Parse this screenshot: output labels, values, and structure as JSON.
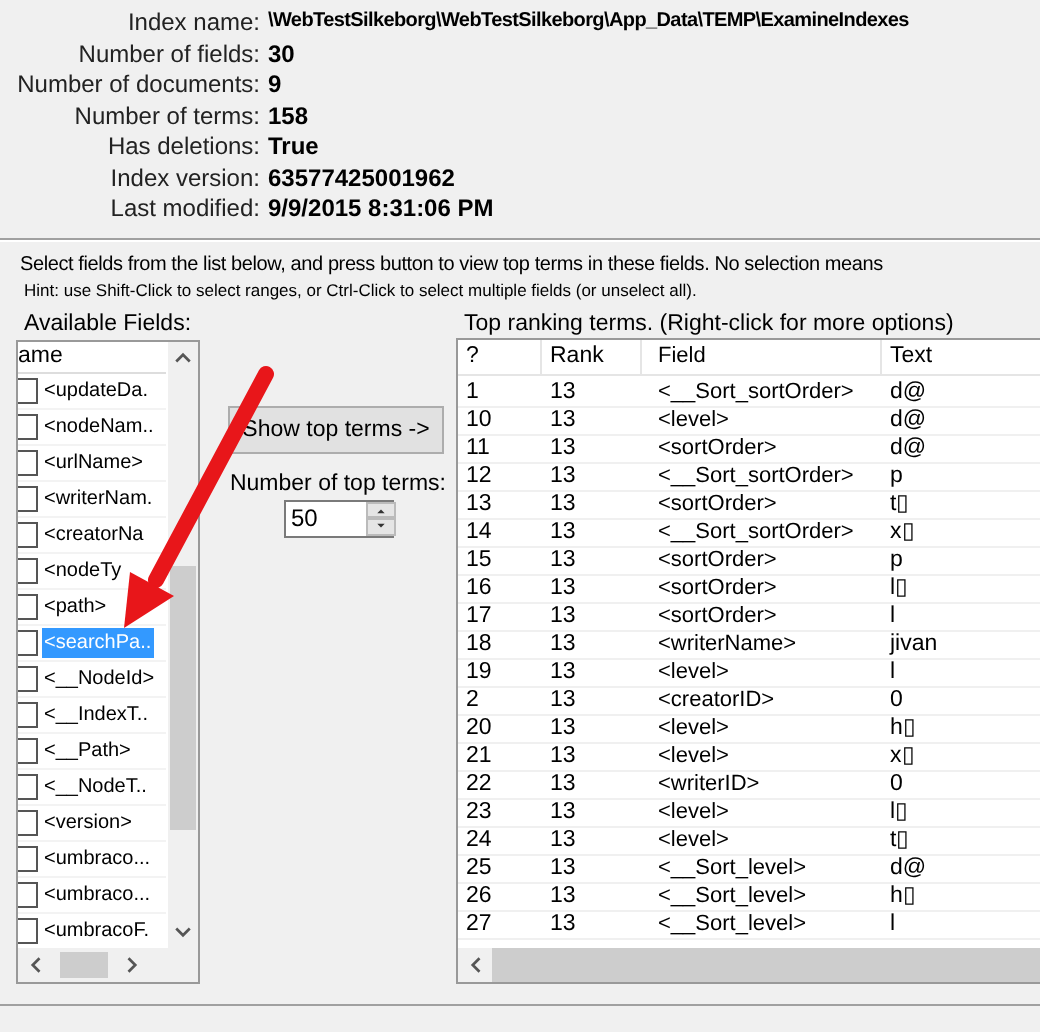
{
  "index_info": [
    {
      "label": "Index name:",
      "lines": [
        "\\WebTestSilkeborg\\WebTestSilkeborg\\App_Data\\TEMP\\ExamineIndexes"
      ]
    },
    {
      "label": "Number of fields:",
      "lines": [
        "30"
      ]
    },
    {
      "label": "Number of documents:",
      "lines": [
        "9"
      ]
    },
    {
      "label": "Number of terms:",
      "lines": [
        "158"
      ]
    },
    {
      "label": "Has deletions:",
      "lines": [
        "True"
      ]
    },
    {
      "label": "Index version:",
      "lines": [
        "63577425001962"
      ]
    },
    {
      "label": "Last modified:",
      "lines": [
        "9/9/2015 8:31:06 PM"
      ]
    }
  ],
  "instructions": "Select fields from the list below, and press button to view top terms in these fields. No selection means",
  "hint": "Hint: use Shift-Click to select ranges, or Ctrl-Click to select multiple fields (or unselect all).",
  "fields_panel": {
    "title": "Available Fields:",
    "column": "ame",
    "items": [
      {
        "label": "<updateDa.",
        "checked": false,
        "selected": false
      },
      {
        "label": "<nodeNam..",
        "checked": false,
        "selected": false
      },
      {
        "label": "<urlName>",
        "checked": false,
        "selected": false
      },
      {
        "label": "<writerNam.",
        "checked": false,
        "selected": false
      },
      {
        "label": "<creatorNa",
        "checked": false,
        "selected": false
      },
      {
        "label": "<nodeTy",
        "checked": false,
        "selected": false
      },
      {
        "label": "<path>",
        "checked": false,
        "selected": false
      },
      {
        "label": "<searchPa..",
        "checked": false,
        "selected": true
      },
      {
        "label": "<__NodeId>",
        "checked": false,
        "selected": false
      },
      {
        "label": "<__IndexT..",
        "checked": false,
        "selected": false
      },
      {
        "label": "<__Path>",
        "checked": false,
        "selected": false
      },
      {
        "label": "<__NodeT..",
        "checked": false,
        "selected": false
      },
      {
        "label": "<version>",
        "checked": false,
        "selected": false
      },
      {
        "label": "<umbraco...",
        "checked": false,
        "selected": false
      },
      {
        "label": "<umbraco...",
        "checked": false,
        "selected": false
      },
      {
        "label": "<umbracoF.",
        "checked": false,
        "selected": false
      }
    ]
  },
  "show_button": "Show top terms ->",
  "top_terms": {
    "label": "Number of top terms:",
    "value": "50"
  },
  "terms_table": {
    "title": "Top ranking terms. (Right-click for more options)",
    "columns": [
      "?",
      "Rank",
      "Field",
      "Text"
    ],
    "rows": [
      [
        "1",
        "13",
        "<__Sort_sortOrder>",
        "d@"
      ],
      [
        "10",
        "13",
        "<level>",
        "d@"
      ],
      [
        "11",
        "13",
        "<sortOrder>",
        "d@"
      ],
      [
        "12",
        "13",
        "<__Sort_sortOrder>",
        "p"
      ],
      [
        "13",
        "13",
        "<sortOrder>",
        "t▯"
      ],
      [
        "14",
        "13",
        "<__Sort_sortOrder>",
        "x▯"
      ],
      [
        "15",
        "13",
        "<sortOrder>",
        "p"
      ],
      [
        "16",
        "13",
        "<sortOrder>",
        "l▯"
      ],
      [
        "17",
        "13",
        "<sortOrder>",
        "l"
      ],
      [
        "18",
        "13",
        "<writerName>",
        "jivan"
      ],
      [
        "19",
        "13",
        "<level>",
        "l"
      ],
      [
        "2",
        "13",
        "<creatorID>",
        "0"
      ],
      [
        "20",
        "13",
        "<level>",
        "h▯"
      ],
      [
        "21",
        "13",
        "<level>",
        "x▯"
      ],
      [
        "22",
        "13",
        "<writerID>",
        "0"
      ],
      [
        "23",
        "13",
        "<level>",
        "l▯"
      ],
      [
        "24",
        "13",
        "<level>",
        "t▯"
      ],
      [
        "25",
        "13",
        "<__Sort_level>",
        "d@"
      ],
      [
        "26",
        "13",
        "<__Sort_level>",
        "h▯"
      ],
      [
        "27",
        "13",
        "<__Sort_level>",
        "l"
      ]
    ]
  }
}
